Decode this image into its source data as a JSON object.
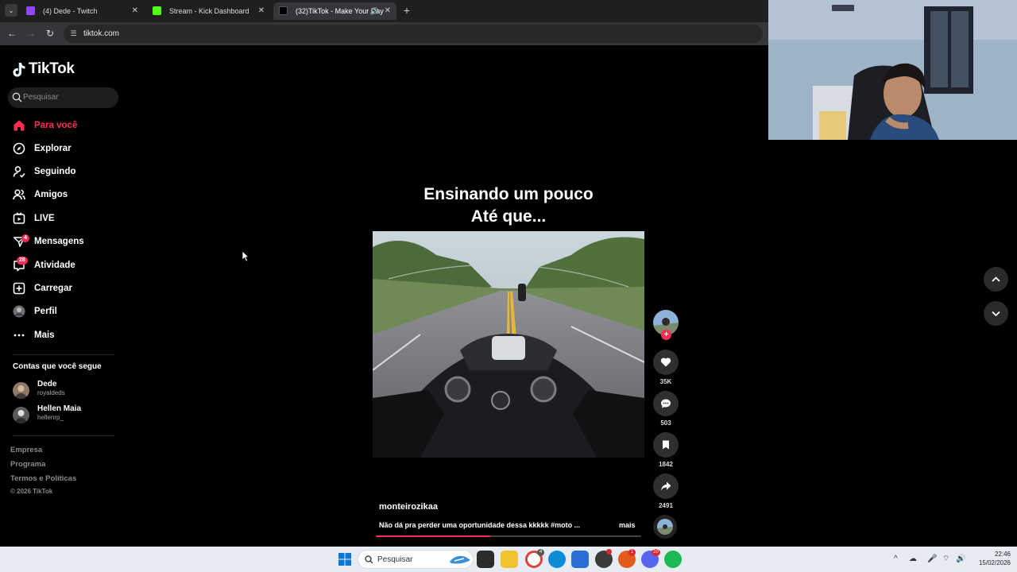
{
  "browser": {
    "tabs": [
      {
        "title": "(4) Dede - Twitch",
        "active": false,
        "favicon_color": "#9146ff"
      },
      {
        "title": "Stream - Kick Dashboard",
        "active": false,
        "favicon_color": "#53fc18"
      },
      {
        "title": "(32)TikTok - Make Your Day",
        "active": true,
        "favicon_color": "#000000"
      }
    ],
    "url": "tiktok.com"
  },
  "sidebar": {
    "logo": "TikTok",
    "search_placeholder": "Pesquisar",
    "nav": [
      {
        "label": "Para você",
        "icon": "home-icon",
        "active": true
      },
      {
        "label": "Explorar",
        "icon": "compass-icon"
      },
      {
        "label": "Seguindo",
        "icon": "user-following-icon"
      },
      {
        "label": "Amigos",
        "icon": "friends-icon"
      },
      {
        "label": "LIVE",
        "icon": "live-icon"
      },
      {
        "label": "Mensagens",
        "icon": "messages-icon",
        "badge": "4"
      },
      {
        "label": "Atividade",
        "icon": "activity-icon",
        "badge": "28"
      },
      {
        "label": "Carregar",
        "icon": "upload-icon"
      },
      {
        "label": "Perfil",
        "icon": "profile-avatar"
      },
      {
        "label": "Mais",
        "icon": "more-icon"
      }
    ],
    "following_title": "Contas que você segue",
    "following": [
      {
        "name": "Dede",
        "username": "royaldeds"
      },
      {
        "name": "Hellen Maia",
        "username": "hellenrp_"
      }
    ],
    "footer_links": [
      "Empresa",
      "Programa",
      "Termos e Políticas"
    ],
    "copyright": "© 2026 TikTok"
  },
  "video": {
    "overlay_line1": "Ensinando um pouco",
    "overlay_line2": "Até que...",
    "author": "monteirozikaa",
    "description": "Não dá pra perder uma oportunidade dessa kkkkk #moto ...",
    "more_label": "mais",
    "progress": 0.43
  },
  "actions": {
    "likes": "35K",
    "comments": "503",
    "saves": "1842",
    "shares": "2491"
  },
  "taskbar": {
    "search_placeholder": "Pesquisar",
    "time": "22:46",
    "date": "15/02/2026",
    "badges": {
      "chrome": "4",
      "app1": "",
      "app2": "1",
      "discord": "20"
    }
  },
  "colors": {
    "accent": "#fe2c55",
    "background": "#000000",
    "sidebar_text": "#ffffff"
  }
}
